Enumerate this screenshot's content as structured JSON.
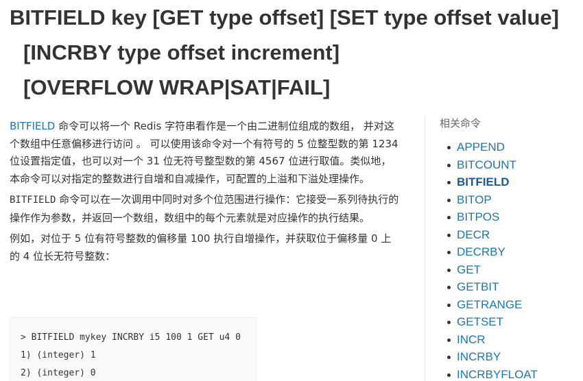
{
  "title": {
    "line1": "BITFIELD key [GET type offset] [SET type offset value]",
    "line2": "[INCRBY type offset increment]",
    "line3": "[OVERFLOW WRAP|SAT|FAIL]"
  },
  "content": {
    "p1_link": "BITFIELD",
    "p1_text": " 命令可以将一个 Redis 字符串看作是一个由二进制位组成的数组， 并对这个数组中任意偏移进行访问 。 可以使用该命令对一个有符号的 5 位整型数的第 1234 位设置指定值，也可以对一个 31 位无符号整型数的第 4567 位进行取值。类似地，本命令可以对指定的整数进行自增和自减操作，可配置的上溢和下溢处理操作。",
    "p2_mono": "BITFIELD",
    "p2_text": " 命令可以在一次调用中同时对多个位范围进行操作：它接受一系列待执行的操作作为参数，并返回一个数组，数组中的每个元素就是对应操作的执行结果。",
    "p3_text": "例如，对位于 5 位有符号整数的偏移量 100 执行自增操作，并获取位于偏移量 0 上的 4 位长无符号整数：",
    "code_lines": [
      "> BITFIELD mykey INCRBY i5 100 1 GET u4 0",
      "1) (integer) 1",
      "2) (integer) 0"
    ]
  },
  "sidebar": {
    "heading": "相关命令",
    "items": [
      {
        "label": "APPEND"
      },
      {
        "label": "BITCOUNT"
      },
      {
        "label": "BITFIELD"
      },
      {
        "label": "BITOP"
      },
      {
        "label": "BITPOS"
      },
      {
        "label": "DECR"
      },
      {
        "label": "DECRBY"
      },
      {
        "label": "GET"
      },
      {
        "label": "GETBIT"
      },
      {
        "label": "GETRANGE"
      },
      {
        "label": "GETSET"
      },
      {
        "label": "INCR"
      },
      {
        "label": "INCRBY"
      },
      {
        "label": "INCRBYFLOAT"
      }
    ],
    "active_label": "BITFIELD"
  },
  "colors": {
    "link": "#1a76b8",
    "text": "#333333",
    "code_bg": "#f9f9f9"
  }
}
